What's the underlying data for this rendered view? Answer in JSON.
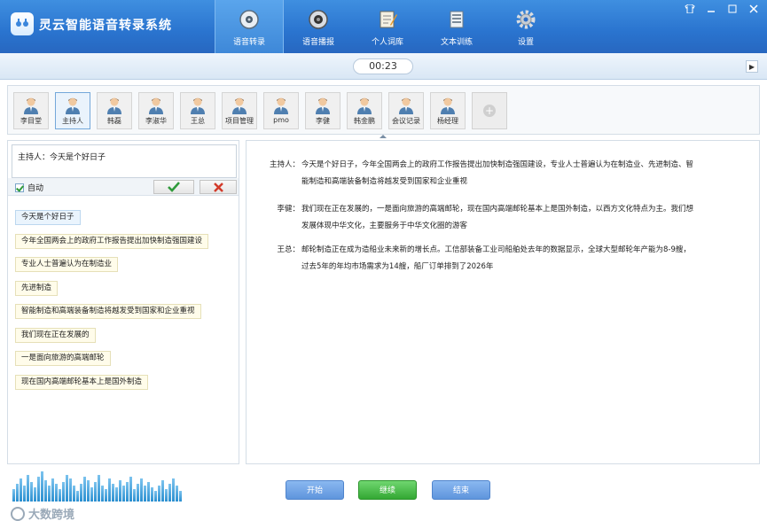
{
  "app": {
    "title": "灵云智能语音转录系统"
  },
  "nav": [
    {
      "label": "语音转录",
      "icon": "record-disc-icon",
      "active": true
    },
    {
      "label": "语音播报",
      "icon": "speaker-broadcast-icon",
      "active": false
    },
    {
      "label": "个人词库",
      "icon": "notebook-pen-icon",
      "active": false
    },
    {
      "label": "文本训练",
      "icon": "text-document-icon",
      "active": false
    },
    {
      "label": "设置",
      "icon": "gear-icon",
      "active": false
    }
  ],
  "window_controls": [
    "shirt-skin-icon",
    "minimize-icon",
    "maximize-icon",
    "close-icon"
  ],
  "timer": {
    "value": "00:23"
  },
  "speakers": [
    {
      "name": "李目堂",
      "active": false
    },
    {
      "name": "主持人",
      "active": true
    },
    {
      "name": "韩磊",
      "active": false
    },
    {
      "name": "李淑华",
      "active": false
    },
    {
      "name": "王总",
      "active": false
    },
    {
      "name": "项目管理",
      "active": false
    },
    {
      "name": "pmo",
      "active": false
    },
    {
      "name": "李健",
      "active": false
    },
    {
      "name": "韩金鹏",
      "active": false
    },
    {
      "name": "会议记录",
      "active": false
    },
    {
      "name": "杨经理",
      "active": false
    }
  ],
  "editor": {
    "current_text": "主持人：今天是个好日子",
    "auto_label": "自动",
    "auto_checked": true
  },
  "phrases": [
    "今天是个好日子",
    "今年全国两会上的政府工作报告提出加快制造强国建设",
    "专业人士普遍认为在制造业",
    "先进制造",
    "智能制造和高端装备制造将越发受到国家和企业重视",
    "我们现在正在发展的",
    "一是面向旅游的高端邮轮",
    "现在国内高端邮轮基本上是国外制造"
  ],
  "transcript": [
    {
      "speaker": "主持人：",
      "lines": [
        "今天是个好日子，今年全国两会上的政府工作报告提出加快制造强国建设，专业人士普遍认为在制造业、先进制造、智",
        "能制造和高端装备制造将越发受到国家和企业重视"
      ]
    },
    {
      "speaker": "李健：",
      "lines": [
        "我们现在正在发展的，一是面向旅游的高端邮轮，现在国内高端邮轮基本上是国外制造，以西方文化特点为主。我们想",
        "发展体现中华文化，主要服务于中华文化圈的游客"
      ]
    },
    {
      "speaker": "王总：",
      "lines": [
        "邮轮制造正在成为造船业未来新的增长点。工信部装备工业司船舶处去年的数据显示，全球大型邮轮年产能为8-9艘，",
        "过去5年的年均市场需求为14艘，船厂订单排到了2026年"
      ]
    }
  ],
  "buttons": {
    "start": "开始",
    "continue": "继续",
    "end": "结束"
  },
  "watermark": "大数跨境",
  "colors": {
    "titlebar": "#2a74cf",
    "continue_button": "#33a833",
    "start_button": "#5f95dd"
  }
}
